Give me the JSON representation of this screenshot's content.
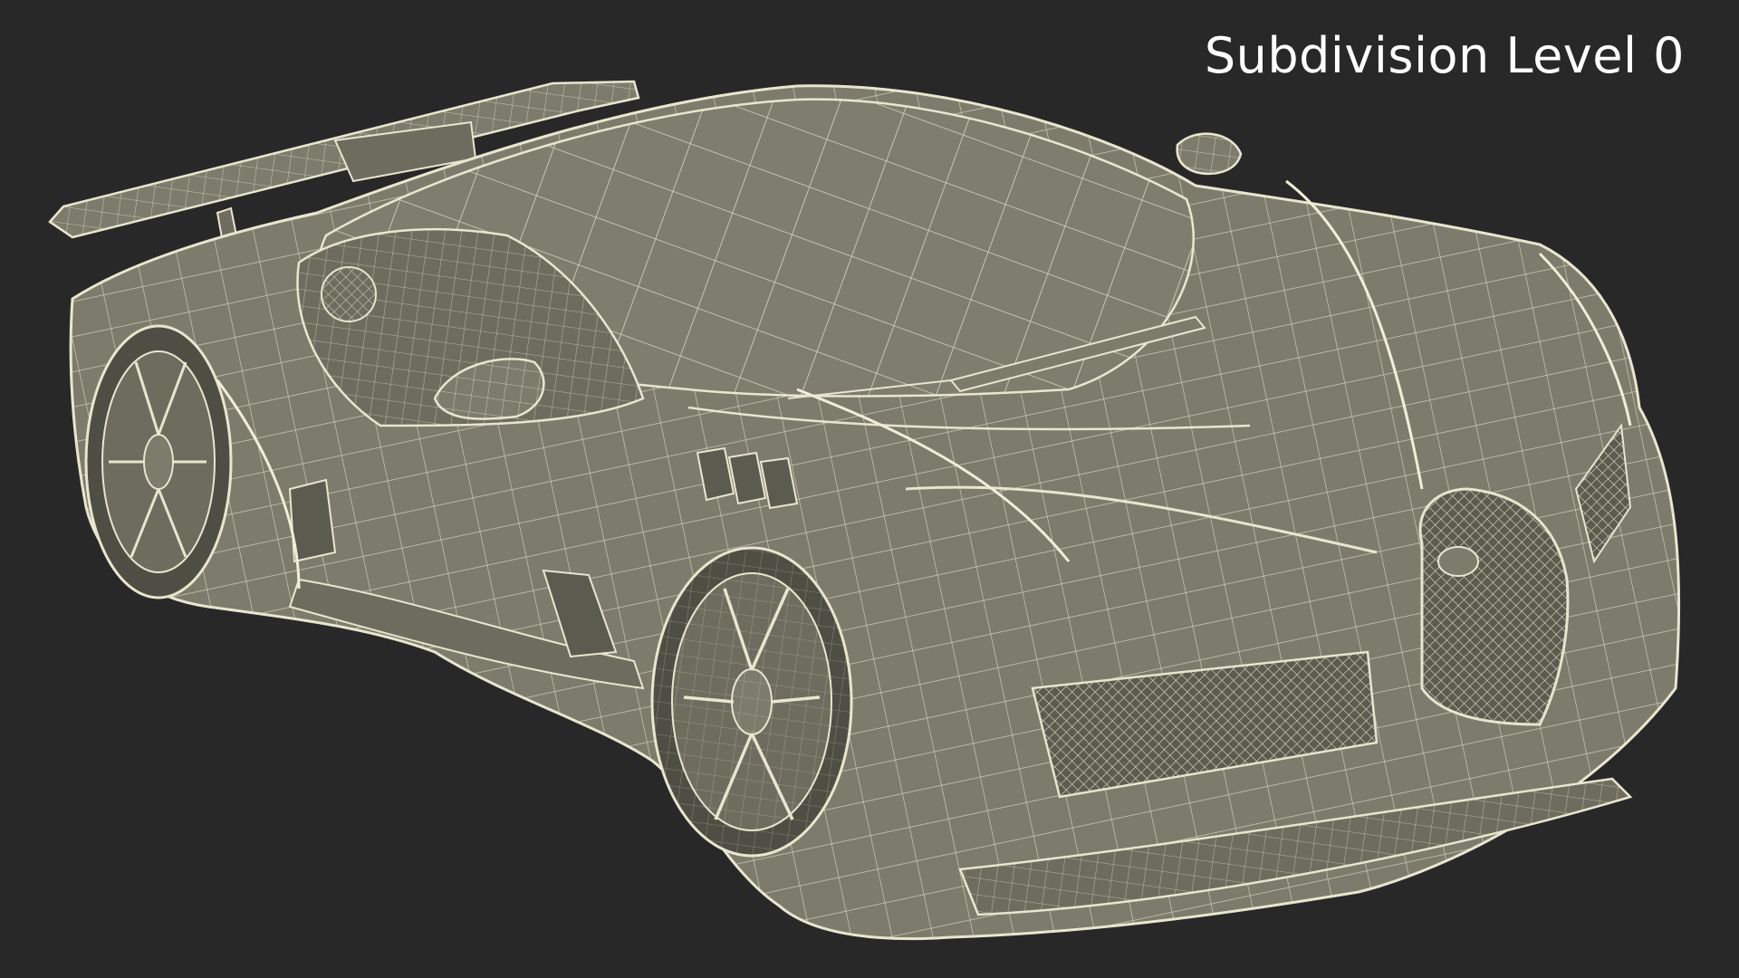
{
  "overlay": {
    "label": "Subdivision Level 0"
  },
  "scene": {
    "subject": "car-wireframe",
    "colors": {
      "background": "#282828",
      "body_fill": "#7c7b6c",
      "body_shade": "#6d6c5e",
      "wire": "#e8e6cf",
      "dark": "#4f4e44"
    }
  }
}
